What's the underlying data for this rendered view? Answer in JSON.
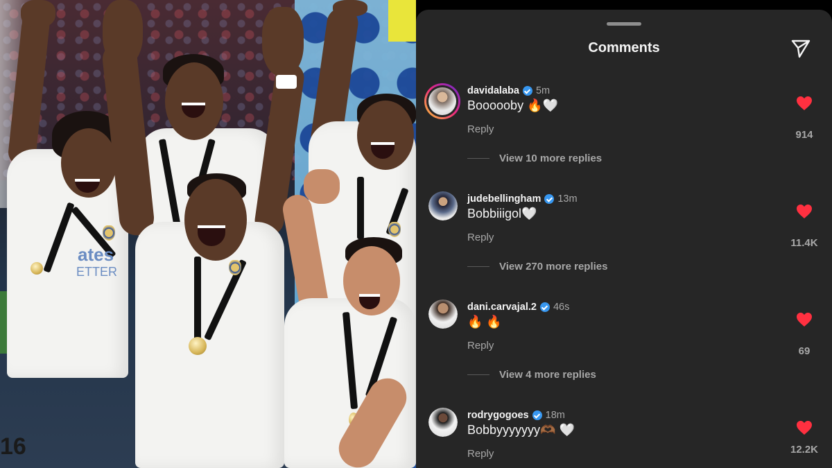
{
  "header": {
    "title": "Comments",
    "share_icon": "paper-plane-icon"
  },
  "colors": {
    "sheet_bg": "#262626",
    "like_red": "#ff3040",
    "verified_blue": "#3797f0",
    "muted_text": "#a8a8a8"
  },
  "photo": {
    "jersey_text_1": "ates",
    "jersey_text_2": "ETTER",
    "jersey_number": "16"
  },
  "comments": [
    {
      "username": "davidalaba",
      "time": "5m",
      "text": "Boooooby 🔥🤍",
      "reply": "Reply",
      "view_more": "View 10 more replies",
      "likes": "914",
      "avatar_story_ring": true
    },
    {
      "username": "judebellingham",
      "time": "13m",
      "text": "Bobbiiigol🤍",
      "reply": "Reply",
      "view_more": "View 270 more replies",
      "likes": "11.4K",
      "avatar_story_ring": false
    },
    {
      "username": "dani.carvajal.2",
      "time": "46s",
      "text": "🔥 🔥",
      "reply": "Reply",
      "view_more": "View 4 more replies",
      "likes": "69",
      "avatar_story_ring": false
    },
    {
      "username": "rodrygogoes",
      "time": "18m",
      "text": "Bobbyyyyyyy🫶🏾 🤍",
      "reply": "Reply",
      "view_more": "",
      "likes": "12.2K",
      "avatar_story_ring": false
    }
  ]
}
